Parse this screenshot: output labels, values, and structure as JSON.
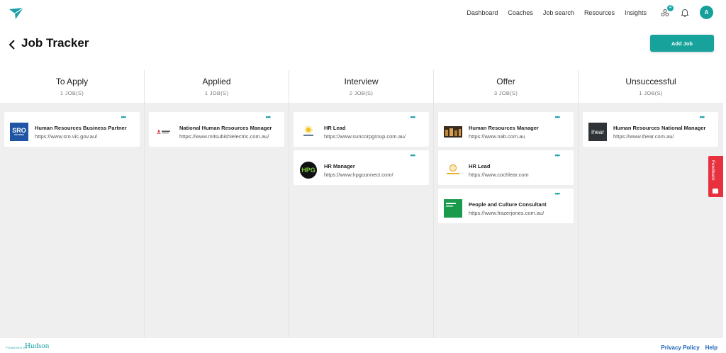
{
  "nav": {
    "links": [
      "Dashboard",
      "Coaches",
      "Job search",
      "Resources",
      "Insights"
    ],
    "notification_count": "4",
    "avatar_initial": "A"
  },
  "header": {
    "title": "Job Tracker",
    "add_button": "Add Job"
  },
  "columns": [
    {
      "title": "To Apply",
      "count": "1 JOB(S)",
      "cards": [
        {
          "title": "Human Resources Business Partner",
          "url": "https://www.sro.vic.gov.au/",
          "logo": "SRO",
          "logo_sub": "VICTORIA"
        }
      ]
    },
    {
      "title": "Applied",
      "count": "1 JOB(S)",
      "cards": [
        {
          "title": "National Human Resources Manager",
          "url": "https://www.mitsubishielectric.com.au/"
        }
      ]
    },
    {
      "title": "Interview",
      "count": "2 JOB(S)",
      "cards": [
        {
          "title": "HR Lead",
          "url": "https://www.suncorpgroup.com.au/"
        },
        {
          "title": "HR Manager",
          "url": "https://www.hpgconnect.com/",
          "logo": "HPG"
        }
      ]
    },
    {
      "title": "Offer",
      "count": "3 JOB(S)",
      "cards": [
        {
          "title": "Human Resources Manager",
          "url": "https://www.nab.com.au"
        },
        {
          "title": "HR Lead",
          "url": "https://www.cochlear.com"
        },
        {
          "title": "People and Culture Consultant",
          "url": "https://www.frazerjones.com.au/"
        }
      ]
    },
    {
      "title": "Unsuccessful",
      "count": "1 JOB(S)",
      "cards": [
        {
          "title": "Human Resources National Manager",
          "url": "https://www.ihear.com.au/",
          "logo": "ihear"
        }
      ]
    }
  ],
  "feedback": {
    "label": "Feedback"
  },
  "footer": {
    "powered_by": "POWERED BY",
    "brand": "Hudson",
    "links": [
      "Privacy Policy",
      "Help"
    ]
  },
  "colors": {
    "accent": "#17a39b",
    "feedback": "#e8313f",
    "link": "#1a62b8"
  }
}
